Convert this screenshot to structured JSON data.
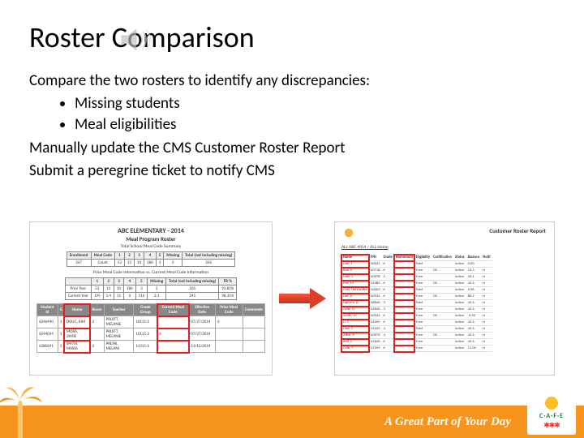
{
  "title": "Roster Comparison",
  "body": {
    "p1": "Compare the two rosters to identify any discrepancies:",
    "bullets": [
      "Missing students",
      "Meal eligibilities"
    ],
    "p2": "Manually update the CMS Customer Roster Report",
    "p3": "Submit a peregrine ticket to notify CMS"
  },
  "fig_left": {
    "title": "ABC ELEMENTARY - 2014",
    "sub": "Meal Program Roster",
    "section1": "Total School Meal Code Summary",
    "t1_headers": [
      "Enrollment",
      "Meal Code",
      "1",
      "2",
      "3",
      "4",
      "5",
      "Missing",
      "Total (not including missing)"
    ],
    "t1_row": [
      "267",
      "Count",
      "53",
      "13",
      "10",
      "186",
      "3",
      "2",
      "265"
    ],
    "section2": "Prior Meal Code Information vs. Current Meal Code Information",
    "t2_headers": [
      "",
      "1",
      "2",
      "3",
      "4",
      "5",
      "Missing",
      "Total (not including missing)",
      "FR %"
    ],
    "t2_rows": [
      [
        "Prior Year",
        "53",
        "13",
        "10",
        "186",
        "3",
        "2",
        "265",
        "92.83%"
      ],
      [
        "Current Year",
        "195",
        "1.4",
        "11",
        "0",
        "116",
        "2.1",
        "245",
        "98.31%"
      ]
    ],
    "t3_headers": [
      "Student Id",
      "G",
      "Name",
      "Room",
      "Teacher",
      "Grade Group",
      "Current Meal Code",
      "Effective Date",
      "Prior Meal Code",
      "Comments"
    ],
    "t3_rows": [
      [
        "6246440",
        "1",
        "DOUG, KIM",
        "2",
        "PRUITT, MELANIE",
        "10111-1",
        "",
        "07/27/2014",
        "6",
        ""
      ],
      [
        "6244014",
        "1",
        "MORA, JAMIE",
        "",
        "PRUITT, MELANIE",
        "10111-2",
        "6",
        "07/27/2014",
        "",
        ""
      ],
      [
        "6280691",
        "1",
        "SMITH, MARIA",
        "2",
        "PREINI, MELANI",
        "11311-1",
        "",
        "11/12/2014",
        "",
        ""
      ]
    ]
  },
  "fig_right": {
    "title": "Customer Roster Report",
    "sub": "ALL ABC   4054 / ALL Home",
    "headers": [
      "Name",
      "PIN",
      "Grade",
      "Homeroom",
      "Eligibility",
      "Certification",
      "Status",
      "Balance",
      "Notif"
    ],
    "rows": [
      [
        "Doe, J",
        "40021",
        "K",
        "",
        "Paid",
        "",
        "Active",
        "0.00",
        ""
      ],
      [
        "Roe, K",
        "40718",
        "K",
        "",
        "Free",
        "DC",
        "Active",
        "15.3",
        "H"
      ],
      [
        "Moe, L",
        "40978",
        "2",
        "",
        "Free",
        "",
        "Active",
        "45.4",
        "H"
      ],
      [
        "Poe, M",
        "41082",
        "K",
        "",
        "Free",
        "DC",
        "Active",
        "45.3",
        "H"
      ],
      [
        "Cruz, Hernandez",
        "42003",
        "K",
        "",
        "Paid",
        "",
        "Active",
        "3.56",
        "H"
      ],
      [
        "Lee, A",
        "40534",
        "K",
        "",
        "Free",
        "DC",
        "Active",
        "80.2",
        "H"
      ],
      [
        "Nguyen, B",
        "48646",
        "3",
        "",
        "Paid",
        "",
        "Active",
        "45.3",
        "H"
      ],
      [
        "Ortiz, N",
        "42636",
        "3",
        "",
        "Free",
        "",
        "Active",
        "45.3",
        "H"
      ],
      [
        "Smith, M",
        "40524",
        "K",
        "",
        "Free",
        "DC",
        "Active",
        "-5.53",
        "H"
      ],
      [
        "Li, C",
        "42490",
        "K",
        "",
        "Free",
        "",
        "Active",
        "45.3",
        "H"
      ],
      [
        "Diaz, C",
        "41032",
        "4",
        "",
        "Paid",
        "",
        "Active",
        "45.3",
        "H"
      ],
      [
        "Allen, R",
        "40976",
        "4",
        "",
        "Free",
        "DC",
        "Active",
        "45.3",
        "H"
      ],
      [
        "Bell, S",
        "41636",
        "K",
        "",
        "Free",
        "",
        "Active",
        "45.3",
        "H"
      ],
      [
        "Cole, T",
        "47299",
        "K",
        "",
        "Free",
        "",
        "Active",
        "11.00",
        "H"
      ]
    ]
  },
  "footer": {
    "tagline": "A Great Part of Your Day",
    "badge_text": "C·A·F·E"
  }
}
